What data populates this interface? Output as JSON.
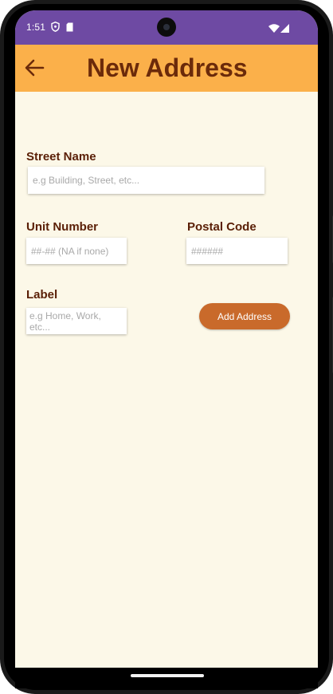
{
  "status_bar": {
    "time": "1:51",
    "color": "#6e4aa3",
    "icons": [
      "shield-icon",
      "sim-card-icon",
      "wifi-icon",
      "signal-icon"
    ]
  },
  "app_bar": {
    "title": "New Address",
    "back_icon": "arrow-left-icon",
    "color": "#fbb04a",
    "title_color": "#6b2a0a"
  },
  "form": {
    "street_name": {
      "label": "Street Name",
      "value": "",
      "placeholder": "e.g Building, Street, etc..."
    },
    "unit_number": {
      "label": "Unit Number",
      "value": "",
      "placeholder": "##-## (NA if none)"
    },
    "postal_code": {
      "label": "Postal Code",
      "value": "",
      "placeholder": "######"
    },
    "label_field": {
      "label": "Label",
      "value": "",
      "placeholder": "e.g Home, Work, etc..."
    },
    "submit_label": "Add Address"
  },
  "colors": {
    "background": "#fcf8e8",
    "label_text": "#5a1f06",
    "button": "#c96a2b"
  }
}
